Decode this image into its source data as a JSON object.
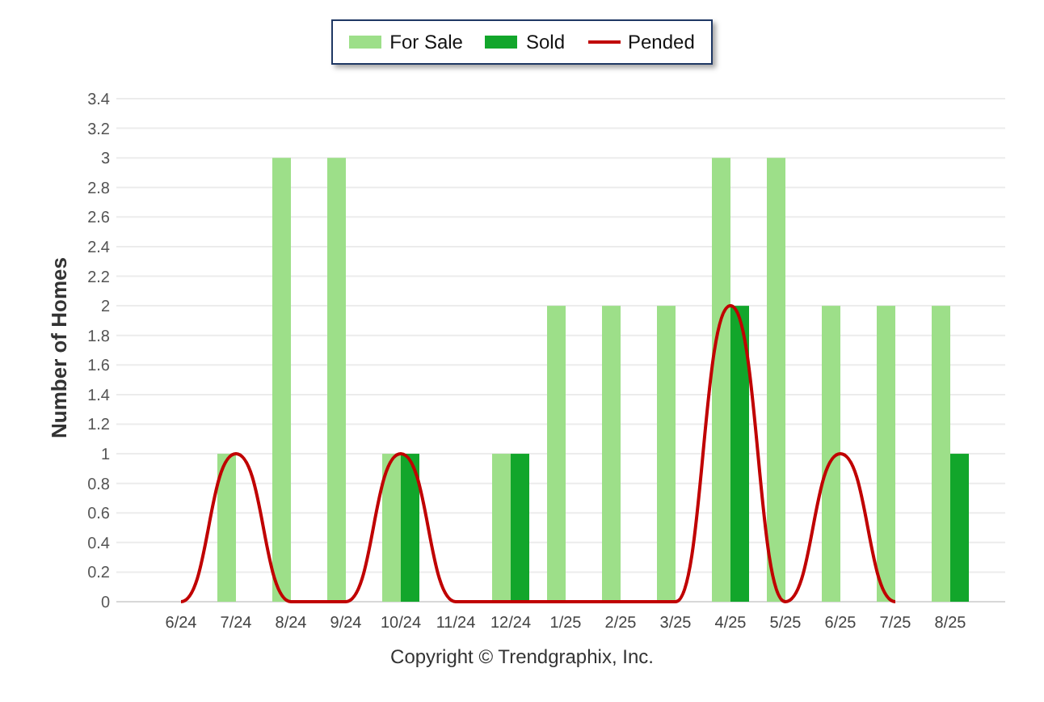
{
  "chart": {
    "chart_data": {
      "type": "bar",
      "ylabel": "Number of Homes",
      "grid": true,
      "categories": [
        "6/24",
        "7/24",
        "8/24",
        "9/24",
        "10/24",
        "11/24",
        "12/24",
        "1/25",
        "2/25",
        "3/25",
        "4/25",
        "5/25",
        "6/25",
        "7/25",
        "8/25"
      ],
      "series": [
        {
          "name": "For Sale",
          "color": "#9ddf89",
          "type": "bar",
          "values": [
            0,
            1,
            3,
            3,
            1,
            0,
            1,
            2,
            2,
            2,
            3,
            3,
            2,
            2,
            2
          ]
        },
        {
          "name": "Sold",
          "color": "#12a62b",
          "type": "bar",
          "values": [
            0,
            0,
            0,
            0,
            1,
            0,
            1,
            0,
            0,
            0,
            2,
            0,
            0,
            0,
            1
          ]
        },
        {
          "name": "Pended",
          "color": "#c00000",
          "type": "line",
          "values": [
            0,
            1,
            0,
            0,
            1,
            0,
            0,
            0,
            0,
            0,
            2,
            0,
            1,
            0,
            null
          ]
        }
      ],
      "ylim": [
        0,
        3.4
      ],
      "yticks": [
        0,
        0.2,
        0.4,
        0.6,
        0.8,
        1,
        1.2,
        1.4,
        1.6,
        1.8,
        2,
        2.2,
        2.4,
        2.6,
        2.8,
        3,
        3.2,
        3.4
      ]
    },
    "copyright": "Copyright © Trendgraphix, Inc."
  }
}
